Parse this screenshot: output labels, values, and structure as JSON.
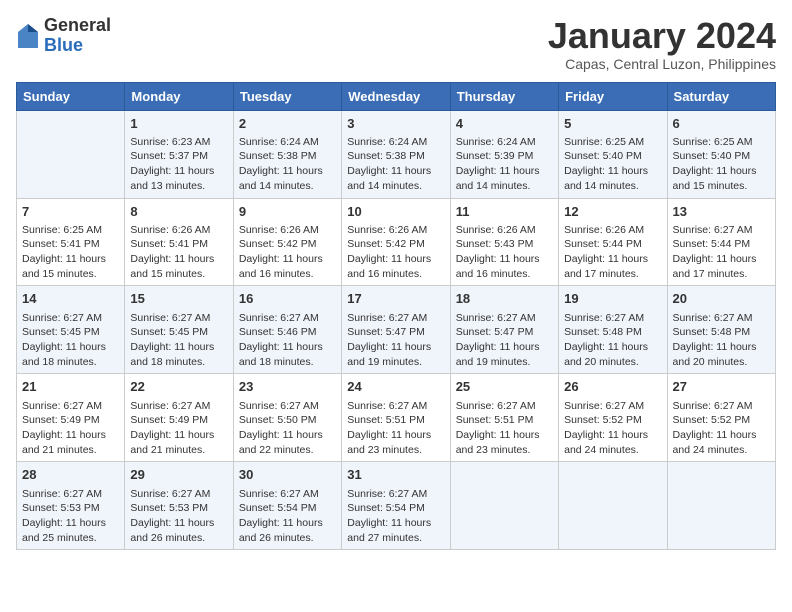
{
  "header": {
    "logo_general": "General",
    "logo_blue": "Blue",
    "month_title": "January 2024",
    "subtitle": "Capas, Central Luzon, Philippines"
  },
  "days_of_week": [
    "Sunday",
    "Monday",
    "Tuesday",
    "Wednesday",
    "Thursday",
    "Friday",
    "Saturday"
  ],
  "weeks": [
    [
      {
        "day": "",
        "content": ""
      },
      {
        "day": "1",
        "content": "Sunrise: 6:23 AM\nSunset: 5:37 PM\nDaylight: 11 hours\nand 13 minutes."
      },
      {
        "day": "2",
        "content": "Sunrise: 6:24 AM\nSunset: 5:38 PM\nDaylight: 11 hours\nand 14 minutes."
      },
      {
        "day": "3",
        "content": "Sunrise: 6:24 AM\nSunset: 5:38 PM\nDaylight: 11 hours\nand 14 minutes."
      },
      {
        "day": "4",
        "content": "Sunrise: 6:24 AM\nSunset: 5:39 PM\nDaylight: 11 hours\nand 14 minutes."
      },
      {
        "day": "5",
        "content": "Sunrise: 6:25 AM\nSunset: 5:40 PM\nDaylight: 11 hours\nand 14 minutes."
      },
      {
        "day": "6",
        "content": "Sunrise: 6:25 AM\nSunset: 5:40 PM\nDaylight: 11 hours\nand 15 minutes."
      }
    ],
    [
      {
        "day": "7",
        "content": "Sunrise: 6:25 AM\nSunset: 5:41 PM\nDaylight: 11 hours\nand 15 minutes."
      },
      {
        "day": "8",
        "content": "Sunrise: 6:26 AM\nSunset: 5:41 PM\nDaylight: 11 hours\nand 15 minutes."
      },
      {
        "day": "9",
        "content": "Sunrise: 6:26 AM\nSunset: 5:42 PM\nDaylight: 11 hours\nand 16 minutes."
      },
      {
        "day": "10",
        "content": "Sunrise: 6:26 AM\nSunset: 5:42 PM\nDaylight: 11 hours\nand 16 minutes."
      },
      {
        "day": "11",
        "content": "Sunrise: 6:26 AM\nSunset: 5:43 PM\nDaylight: 11 hours\nand 16 minutes."
      },
      {
        "day": "12",
        "content": "Sunrise: 6:26 AM\nSunset: 5:44 PM\nDaylight: 11 hours\nand 17 minutes."
      },
      {
        "day": "13",
        "content": "Sunrise: 6:27 AM\nSunset: 5:44 PM\nDaylight: 11 hours\nand 17 minutes."
      }
    ],
    [
      {
        "day": "14",
        "content": "Sunrise: 6:27 AM\nSunset: 5:45 PM\nDaylight: 11 hours\nand 18 minutes."
      },
      {
        "day": "15",
        "content": "Sunrise: 6:27 AM\nSunset: 5:45 PM\nDaylight: 11 hours\nand 18 minutes."
      },
      {
        "day": "16",
        "content": "Sunrise: 6:27 AM\nSunset: 5:46 PM\nDaylight: 11 hours\nand 18 minutes."
      },
      {
        "day": "17",
        "content": "Sunrise: 6:27 AM\nSunset: 5:47 PM\nDaylight: 11 hours\nand 19 minutes."
      },
      {
        "day": "18",
        "content": "Sunrise: 6:27 AM\nSunset: 5:47 PM\nDaylight: 11 hours\nand 19 minutes."
      },
      {
        "day": "19",
        "content": "Sunrise: 6:27 AM\nSunset: 5:48 PM\nDaylight: 11 hours\nand 20 minutes."
      },
      {
        "day": "20",
        "content": "Sunrise: 6:27 AM\nSunset: 5:48 PM\nDaylight: 11 hours\nand 20 minutes."
      }
    ],
    [
      {
        "day": "21",
        "content": "Sunrise: 6:27 AM\nSunset: 5:49 PM\nDaylight: 11 hours\nand 21 minutes."
      },
      {
        "day": "22",
        "content": "Sunrise: 6:27 AM\nSunset: 5:49 PM\nDaylight: 11 hours\nand 21 minutes."
      },
      {
        "day": "23",
        "content": "Sunrise: 6:27 AM\nSunset: 5:50 PM\nDaylight: 11 hours\nand 22 minutes."
      },
      {
        "day": "24",
        "content": "Sunrise: 6:27 AM\nSunset: 5:51 PM\nDaylight: 11 hours\nand 23 minutes."
      },
      {
        "day": "25",
        "content": "Sunrise: 6:27 AM\nSunset: 5:51 PM\nDaylight: 11 hours\nand 23 minutes."
      },
      {
        "day": "26",
        "content": "Sunrise: 6:27 AM\nSunset: 5:52 PM\nDaylight: 11 hours\nand 24 minutes."
      },
      {
        "day": "27",
        "content": "Sunrise: 6:27 AM\nSunset: 5:52 PM\nDaylight: 11 hours\nand 24 minutes."
      }
    ],
    [
      {
        "day": "28",
        "content": "Sunrise: 6:27 AM\nSunset: 5:53 PM\nDaylight: 11 hours\nand 25 minutes."
      },
      {
        "day": "29",
        "content": "Sunrise: 6:27 AM\nSunset: 5:53 PM\nDaylight: 11 hours\nand 26 minutes."
      },
      {
        "day": "30",
        "content": "Sunrise: 6:27 AM\nSunset: 5:54 PM\nDaylight: 11 hours\nand 26 minutes."
      },
      {
        "day": "31",
        "content": "Sunrise: 6:27 AM\nSunset: 5:54 PM\nDaylight: 11 hours\nand 27 minutes."
      },
      {
        "day": "",
        "content": ""
      },
      {
        "day": "",
        "content": ""
      },
      {
        "day": "",
        "content": ""
      }
    ]
  ]
}
